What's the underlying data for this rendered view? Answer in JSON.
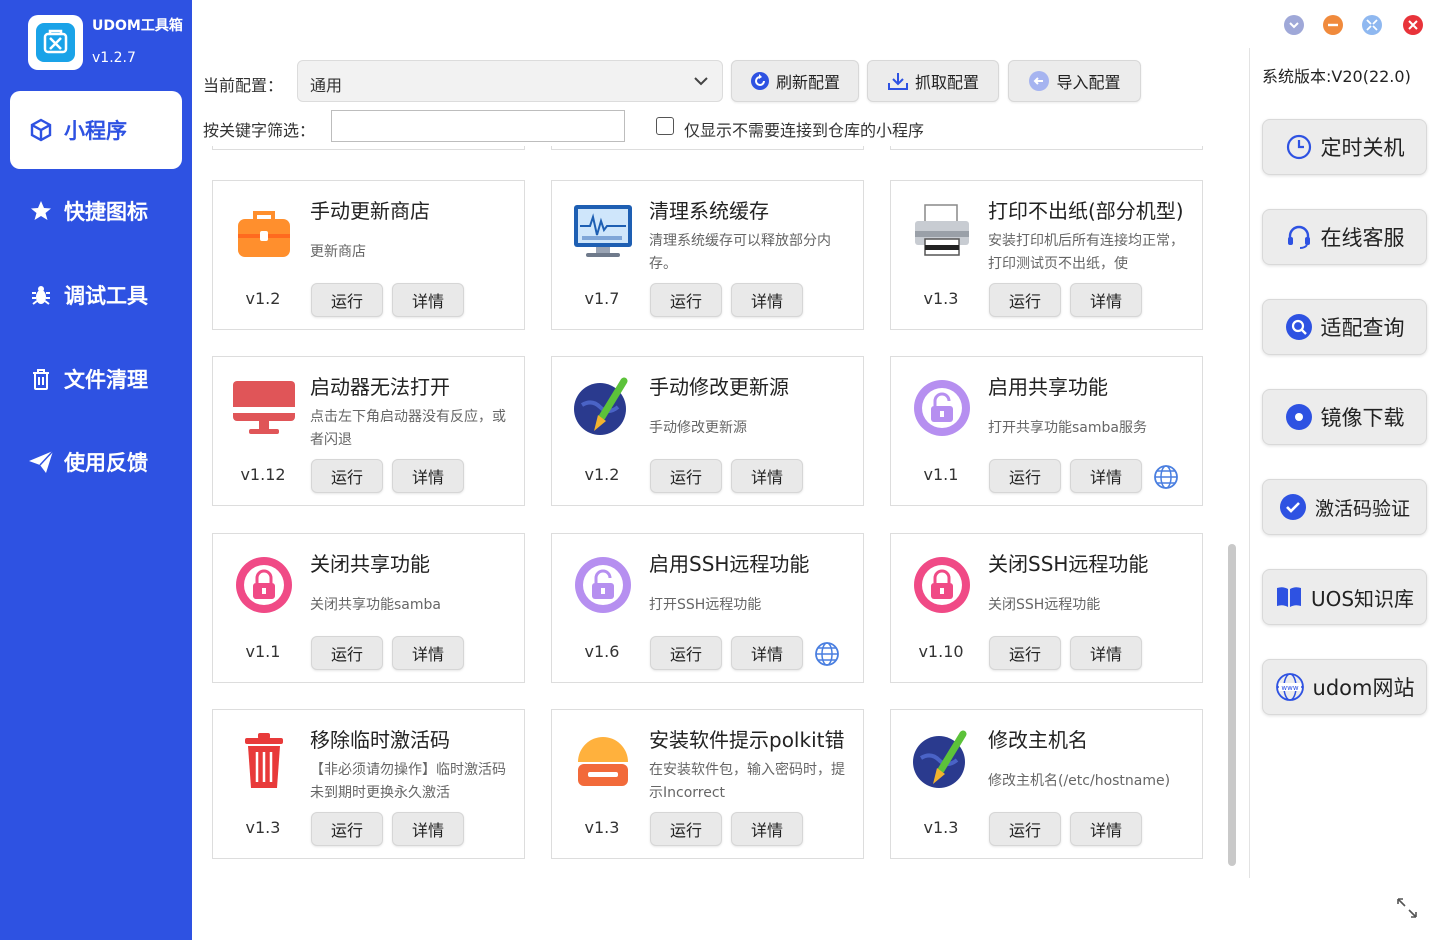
{
  "app": {
    "title": "UDOM工具箱",
    "version": "v1.2.7"
  },
  "nav": [
    {
      "label": "小程序",
      "icon": "cube-icon",
      "active": true
    },
    {
      "label": "快捷图标",
      "icon": "star-icon"
    },
    {
      "label": "调试工具",
      "icon": "bug-icon"
    },
    {
      "label": "文件清理",
      "icon": "trash-icon"
    },
    {
      "label": "使用反馈",
      "icon": "paper-plane-icon"
    }
  ],
  "toolbar": {
    "config_label": "当前配置：",
    "config_value": "通用",
    "refresh_label": "刷新配置",
    "fetch_label": "抓取配置",
    "import_label": "导入配置",
    "filter_label": "按关键字筛选：",
    "filter_value": "",
    "checkbox_label": "仅显示不需要连接到仓库的小程序",
    "checkbox_checked": false
  },
  "common": {
    "run_label": "运行",
    "detail_label": "详情"
  },
  "cards": [
    {
      "title": "手动更新商店",
      "desc": "更新商店",
      "version": "v1.2",
      "icon": "toolbox-icon"
    },
    {
      "title": "清理系统缓存",
      "desc": "清理系统缓存可以释放部分内存。",
      "version": "v1.7",
      "icon": "monitor-icon"
    },
    {
      "title": "打印不出纸(部分机型)",
      "desc": "安装打印机后所有连接均正常，打印测试页不出纸，使",
      "version": "v1.3",
      "icon": "printer-icon"
    },
    {
      "title": "启动器无法打开",
      "desc": "点击左下角启动器没有反应，或者闪退",
      "version": "v1.12",
      "icon": "display-icon"
    },
    {
      "title": "手动修改更新源",
      "desc": "手动修改更新源",
      "version": "v1.2",
      "icon": "pen-globe-icon"
    },
    {
      "title": "启用共享功能",
      "desc": "打开共享功能samba服务",
      "version": "v1.1",
      "icon": "unlock-icon",
      "globe": true
    },
    {
      "title": "关闭共享功能",
      "desc": "关闭共享功能samba",
      "version": "v1.1",
      "icon": "lock-icon"
    },
    {
      "title": "启用SSH远程功能",
      "desc": "打开SSH远程功能",
      "version": "v1.6",
      "icon": "unlock-icon",
      "globe": true
    },
    {
      "title": "关闭SSH远程功能",
      "desc": "关闭SSH远程功能",
      "version": "v1.10",
      "icon": "lock-icon"
    },
    {
      "title": "移除临时激活码",
      "desc": "【非必须请勿操作】临时激活码未到期时更换永久激活",
      "version": "v1.3",
      "icon": "trash-can-icon"
    },
    {
      "title": "安装软件提示polkit错",
      "desc": "在安装软件包，输入密码时，提示Incorrect",
      "version": "v1.3",
      "icon": "hamburger-icon"
    },
    {
      "title": "修改主机名",
      "desc": "修改主机名(/etc/hostname)",
      "version": "v1.3",
      "icon": "pen-globe-icon"
    }
  ],
  "right": {
    "sys_version": "系统版本:V20(22.0)",
    "buttons": [
      {
        "label": "定时关机",
        "icon": "clock-icon"
      },
      {
        "label": "在线客服",
        "icon": "headset-icon"
      },
      {
        "label": "适配查询",
        "icon": "search-icon"
      },
      {
        "label": "镜像下载",
        "icon": "disc-icon"
      },
      {
        "label": "激活码验证",
        "icon": "check-circle-icon"
      },
      {
        "label": "UOS知识库",
        "icon": "book-icon"
      },
      {
        "label": "udom网站",
        "icon": "www-globe-icon"
      }
    ]
  },
  "colors": {
    "sidebar": "#2e52e2",
    "accent": "#2e52e2"
  }
}
